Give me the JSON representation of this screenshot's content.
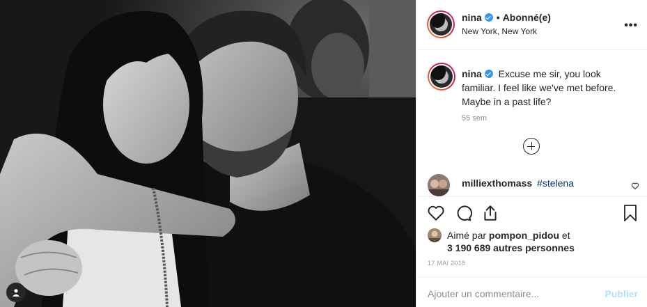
{
  "post": {
    "author": "nina",
    "separator": "•",
    "follow_status": "Abonné(e)",
    "location": "New York, New York",
    "more_icon": "more-horizontal-icon",
    "caption": {
      "user": "nina",
      "text": "Excuse me sir, you look familiar. I feel like we've met before. Maybe in a past life?",
      "time": "55 sem"
    },
    "comments": [
      {
        "user": "milliexthomass",
        "text": "#stelena"
      }
    ],
    "likes": {
      "prefix": "Aimé par",
      "first_liker": "pompon_pidou",
      "joiner": "et",
      "others": "3 190 689 autres personnes"
    },
    "date": "17 MAI 2018",
    "add_comment_placeholder": "Ajouter un commentaire...",
    "publish_label": "Publier"
  },
  "icons": [
    "verified-badge-icon",
    "load-more-comments-icon",
    "heart-icon",
    "comment-icon",
    "share-icon",
    "bookmark-icon",
    "user-tag-icon"
  ],
  "colors": {
    "verified": "#3897f0",
    "publish_disabled": "#b2dffc",
    "hashtag": "#003569"
  }
}
